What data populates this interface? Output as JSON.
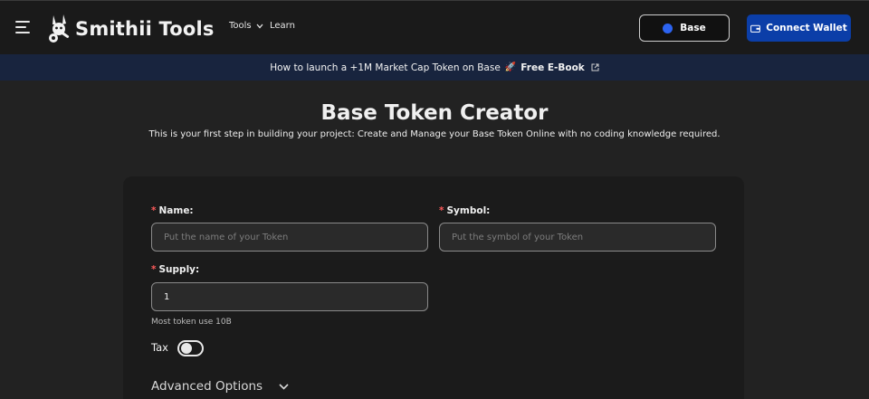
{
  "header": {
    "brand": "Smithii Tools",
    "nav": [
      {
        "label": "Tools"
      },
      {
        "label": "Learn"
      }
    ],
    "network_button": "Base",
    "connect_button": "Connect Wallet"
  },
  "banner": {
    "text": "How to launch a +1M Market Cap Token on Base",
    "emoji": "🚀",
    "cta": "Free E-Book"
  },
  "page": {
    "title": "Base Token Creator",
    "subtitle": "This is your first step in building your project: Create and Manage your Base Token Online with no coding knowledge required."
  },
  "form": {
    "name": {
      "label": "Name:",
      "required_mark": "*",
      "placeholder": "Put the name of your Token"
    },
    "symbol": {
      "label": "Symbol:",
      "required_mark": "*",
      "placeholder": "Put the symbol of your Token"
    },
    "supply": {
      "label": "Supply:",
      "required_mark": "*",
      "value": "1",
      "hint": "Most token use 10B"
    },
    "tax": {
      "label": "Tax",
      "enabled": false
    },
    "advanced": {
      "label": "Advanced Options"
    }
  },
  "colors": {
    "background": "#222222",
    "topbar": "#1a1a1a",
    "banner": "#18243e",
    "card": "#1b1b1b",
    "connect_button": "#0b3ea8",
    "base_dot": "#2c63f0",
    "required_mark": "#ff5b5b"
  },
  "icons": {
    "menu": "hamburger-icon",
    "tools_dropdown": "chevron-down-icon",
    "network": "base-network-icon",
    "wallet": "wallet-icon",
    "external_link": "external-link-icon",
    "advanced_toggle": "chevron-down-icon"
  }
}
